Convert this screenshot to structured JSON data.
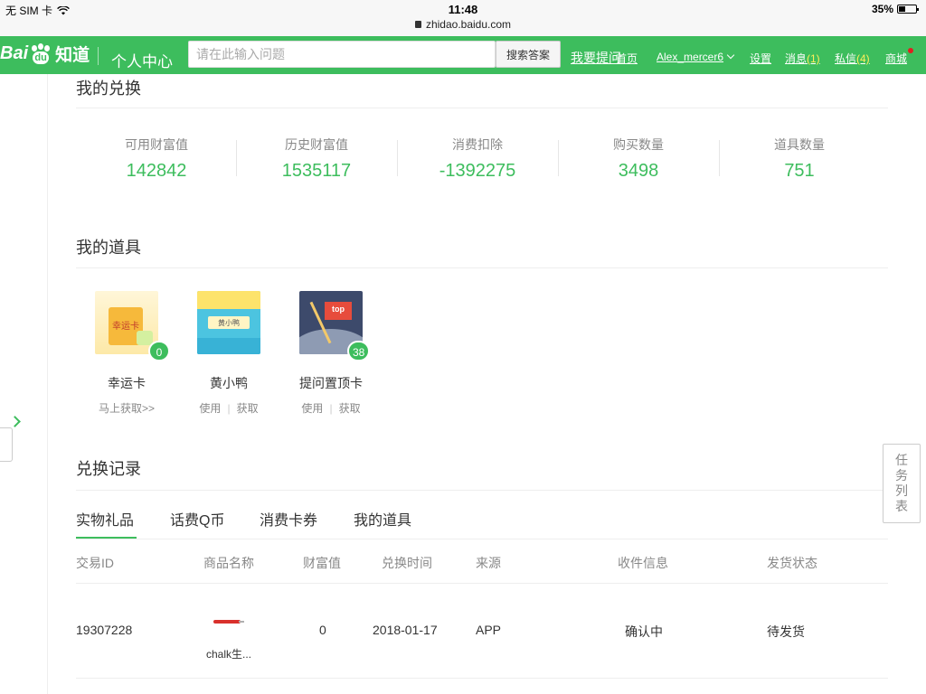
{
  "status_bar": {
    "carrier": "无 SIM 卡",
    "time": "11:48",
    "url": "zhidao.baidu.com",
    "battery": "35%"
  },
  "header": {
    "logo_bai": "Bai",
    "logo_du": "du",
    "logo_zhidao": "知道",
    "page_title": "个人中心",
    "search_placeholder": "请在此输入问题",
    "search_button": "搜索答案",
    "ask_link": "我要提问",
    "nav": {
      "home": "首页",
      "username": "Alex_mercer6",
      "settings": "设置",
      "messages": "消息",
      "messages_count": "(1)",
      "private_msg": "私信",
      "private_count": "(4)",
      "mall": "商城"
    },
    "accent_color": "#3dbd5d"
  },
  "exchange": {
    "title": "我的兑换",
    "stats": [
      {
        "label": "可用财富值",
        "value": "142842"
      },
      {
        "label": "历史财富值",
        "value": "1535117"
      },
      {
        "label": "消费扣除",
        "value": "-1392275"
      },
      {
        "label": "购买数量",
        "value": "3498"
      },
      {
        "label": "道具数量",
        "value": "751"
      }
    ]
  },
  "tools": {
    "title": "我的道具",
    "items": [
      {
        "name": "幸运卡",
        "badge": "0",
        "image_label": "幸运卡",
        "action": "马上获取>>"
      },
      {
        "name": "黄小鸭",
        "image_label": "黄小鸭",
        "action1": "使用",
        "action2": "获取"
      },
      {
        "name": "提问置顶卡",
        "badge": "38",
        "image_label": "top",
        "action1": "使用",
        "action2": "获取"
      }
    ]
  },
  "records": {
    "title": "兑换记录",
    "tabs": [
      "实物礼品",
      "话费Q币",
      "消费卡券",
      "我的道具"
    ],
    "columns": [
      "交易ID",
      "商品名称",
      "财富值",
      "兑换时间",
      "来源",
      "收件信息",
      "发货状态"
    ],
    "rows": [
      {
        "id": "19307228",
        "product": "chalk生...",
        "wealth": "0",
        "time": "2018-01-17",
        "source": "APP",
        "recipient": "确认中",
        "status": "待发货"
      }
    ]
  },
  "task_list": {
    "chars": [
      "任",
      "务",
      "列",
      "表"
    ]
  }
}
